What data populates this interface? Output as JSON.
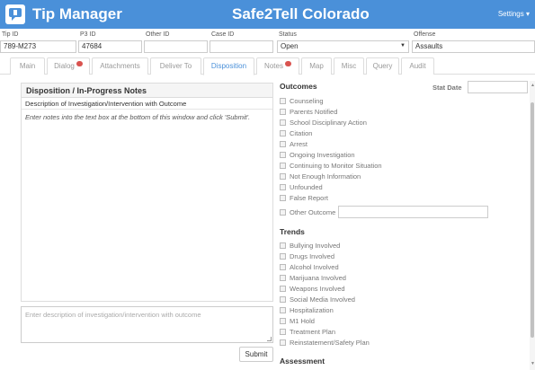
{
  "header": {
    "app_title": "Tip Manager",
    "org_title": "Safe2Tell Colorado",
    "settings_label": "Settings ▾",
    "logo_icon": "tip-manager-logo-icon"
  },
  "fields": {
    "tip_id": {
      "label": "Tip ID",
      "value": "789-M273"
    },
    "p3_id": {
      "label": "P3 ID",
      "value": "47684"
    },
    "other_id": {
      "label": "Other ID",
      "value": ""
    },
    "case_id": {
      "label": "Case ID",
      "value": ""
    },
    "status": {
      "label": "Status",
      "value": "Open"
    },
    "offense": {
      "label": "Offense",
      "value": "Assaults"
    }
  },
  "tabs": [
    {
      "label": "Main"
    },
    {
      "label": "Dialog"
    },
    {
      "label": "Attachments"
    },
    {
      "label": "Deliver To"
    },
    {
      "label": "Disposition"
    },
    {
      "label": "Notes"
    },
    {
      "label": "Map"
    },
    {
      "label": "Misc"
    },
    {
      "label": "Query"
    },
    {
      "label": "Audit"
    }
  ],
  "active_tab": "Disposition",
  "notes_panel": {
    "title": "Disposition / In-Progress Notes",
    "subtitle": "Description of Investigation/Intervention with Outcome",
    "hint": "Enter notes into the text box at the bottom of this window and click 'Submit'.",
    "input_placeholder": "Enter description of investigation/intervention with outcome",
    "submit_label": "Submit"
  },
  "outcomes": {
    "title": "Outcomes",
    "stat_date_label": "Stat Date",
    "items": [
      "Counseling",
      "Parents Notified",
      "School Disciplinary Action",
      "Citation",
      "Arrest",
      "Ongoing Investigation",
      "Continuing to Monitor Situation",
      "Not Enough Information",
      "Unfounded",
      "False Report",
      "Other Outcome"
    ]
  },
  "trends": {
    "title": "Trends",
    "items": [
      "Bullying Involved",
      "Drugs Involved",
      "Alcohol Involved",
      "Marijuana Involved",
      "Weapons Involved",
      "Social Media Involved",
      "Hospitalization",
      "M1 Hold",
      "Treatment Plan",
      "Reinstatement/Safety Plan"
    ]
  },
  "assessment": {
    "title": "Assessment"
  },
  "colors": {
    "header_bg": "#4a90d9",
    "active_tab": "#4a90d9",
    "badge": "#d9534f"
  }
}
